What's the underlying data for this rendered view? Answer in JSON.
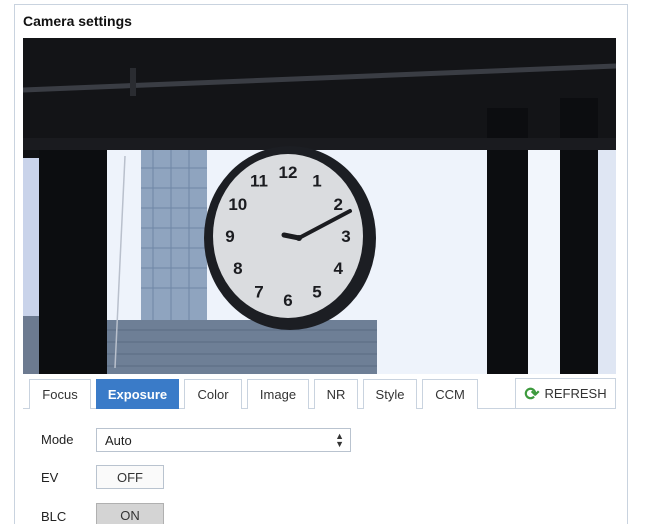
{
  "panel": {
    "title": "Camera settings"
  },
  "tabs": [
    {
      "label": "Focus",
      "active": false
    },
    {
      "label": "Exposure",
      "active": true
    },
    {
      "label": "Color",
      "active": false
    },
    {
      "label": "Image",
      "active": false
    },
    {
      "label": "NR",
      "active": false
    },
    {
      "label": "Style",
      "active": false
    },
    {
      "label": "CCM",
      "active": false
    }
  ],
  "refresh": {
    "label": "REFRESH",
    "icon": "refresh-icon",
    "icon_color": "#3d9a3d"
  },
  "settings": {
    "mode": {
      "label": "Mode",
      "value": "Auto"
    },
    "ev": {
      "label": "EV",
      "value": "OFF"
    },
    "blc": {
      "label": "BLC",
      "value": "ON"
    }
  },
  "camera_view": {
    "clock_numbers": [
      "12",
      "1",
      "2",
      "3",
      "4",
      "5",
      "6",
      "7",
      "8",
      "9",
      "10",
      "11"
    ]
  },
  "colors": {
    "accent": "#3a7bc8",
    "border": "#c9d3df"
  }
}
